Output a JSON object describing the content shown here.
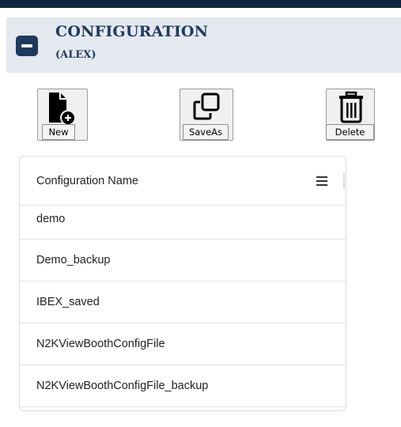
{
  "panel": {
    "title": "CONFIGURATION",
    "subtitle": "(ALEX)"
  },
  "toolbar": {
    "new_label": "New",
    "saveas_label": "SaveAs",
    "delete_label": "Delete"
  },
  "grid": {
    "column_header": "Configuration Name",
    "rows": [
      "demo",
      "Demo_backup",
      "IBEX_saved",
      "N2KViewBoothConfigFile",
      "N2KViewBoothConfigFile_backup"
    ]
  },
  "icons": {
    "collapse": "minus-icon",
    "new": "new-file-icon",
    "saveas": "copy-icon",
    "delete": "trash-icon",
    "column_menu": "menu-icon"
  },
  "colors": {
    "accent": "#1f3a5f",
    "top_bar": "#0f2540",
    "header_bg": "#e4e8ef"
  }
}
